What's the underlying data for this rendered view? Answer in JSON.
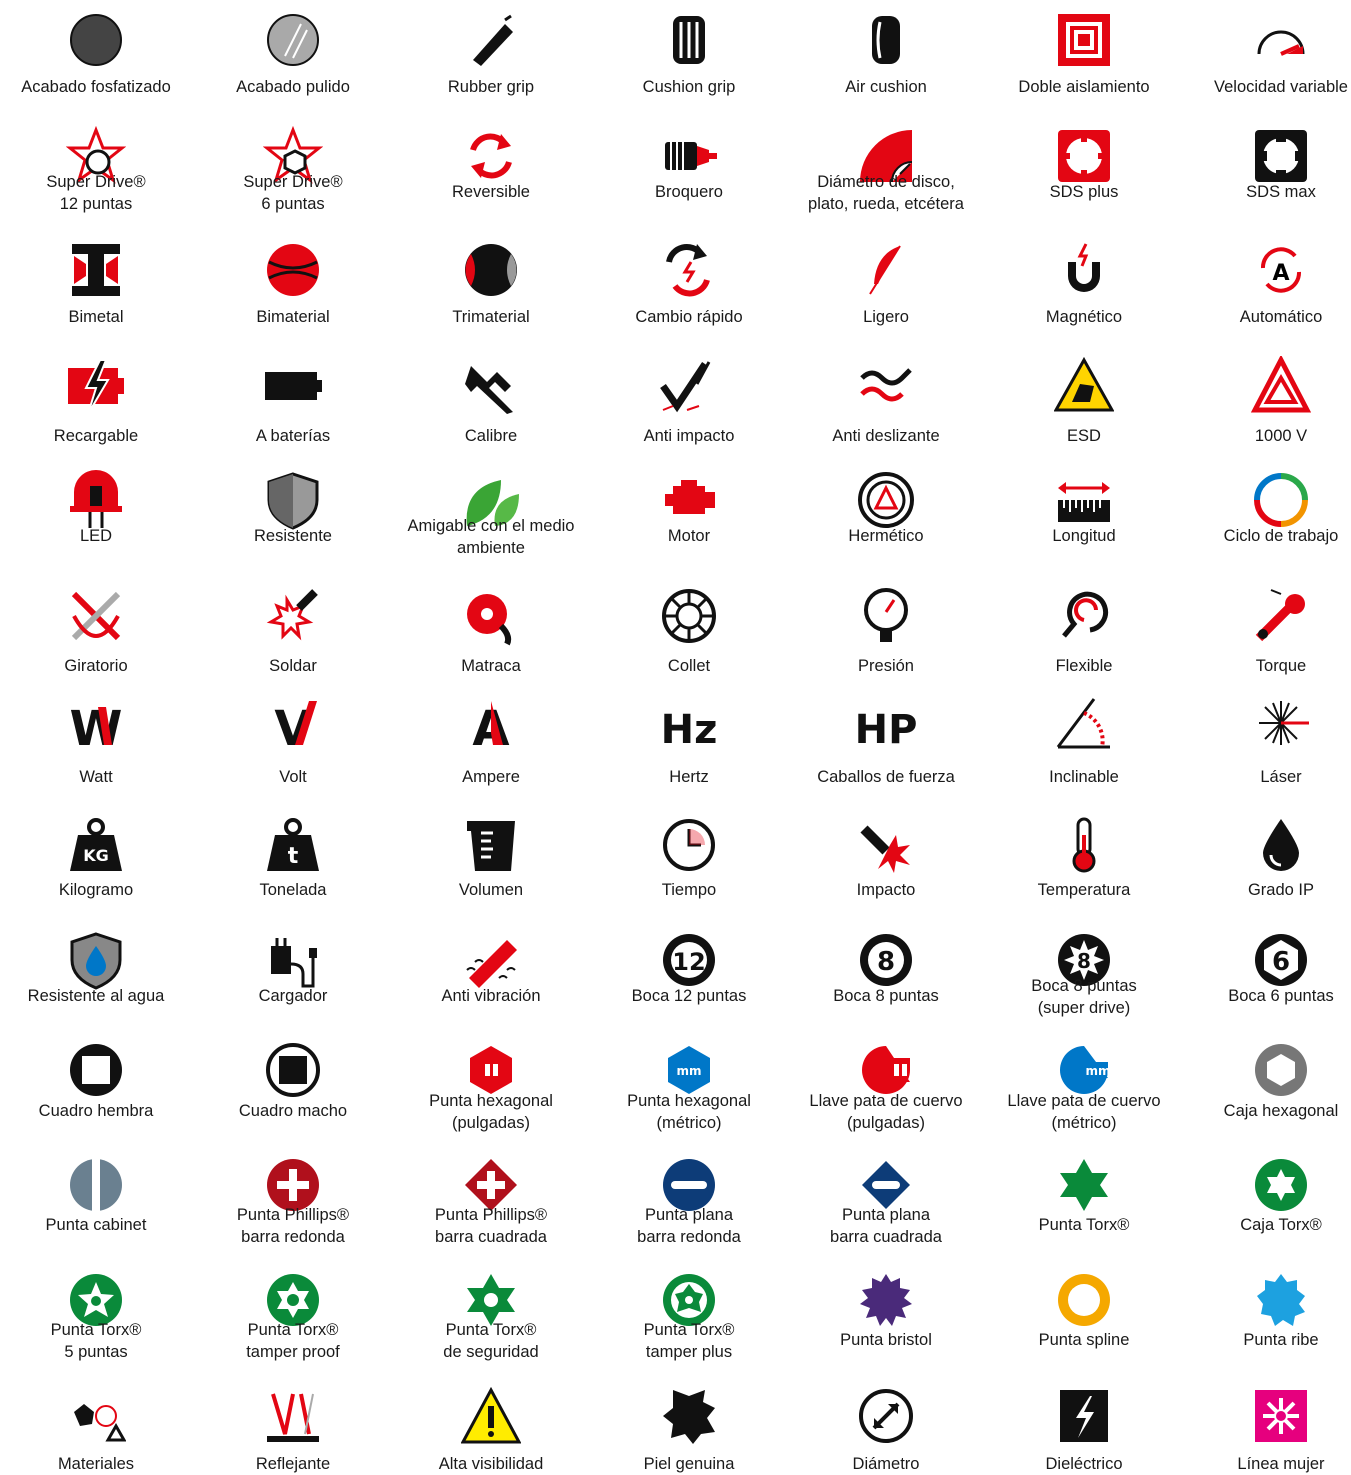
{
  "colors": {
    "red": "#e30613",
    "black": "#111111",
    "gray": "#8a8a8a",
    "green": "#0a8a3a",
    "blue": "#0077c8"
  },
  "icons": [
    {
      "name": "phosphate-finish-icon",
      "lines": [
        "Acabado fosfatizado"
      ]
    },
    {
      "name": "polished-finish-icon",
      "lines": [
        "Acabado pulido"
      ]
    },
    {
      "name": "rubber-grip-icon",
      "lines": [
        "Rubber grip"
      ]
    },
    {
      "name": "cushion-grip-icon",
      "lines": [
        "Cushion grip"
      ]
    },
    {
      "name": "air-cushion-icon",
      "lines": [
        "Air cushion"
      ]
    },
    {
      "name": "double-insulation-icon",
      "lines": [
        "Doble aislamiento"
      ]
    },
    {
      "name": "variable-speed-icon",
      "lines": [
        "Velocidad variable"
      ]
    },
    {
      "name": "super-drive-12-icon",
      "lines": [
        "Super Drive®",
        "12 puntas"
      ]
    },
    {
      "name": "super-drive-6-icon",
      "lines": [
        "Super Drive®",
        "6 puntas"
      ]
    },
    {
      "name": "reversible-icon",
      "lines": [
        "Reversible"
      ]
    },
    {
      "name": "chuck-icon",
      "lines": [
        "Broquero"
      ]
    },
    {
      "name": "disc-diameter-icon",
      "lines": [
        "Diámetro de disco,",
        "plato, rueda, etcétera"
      ]
    },
    {
      "name": "sds-plus-icon",
      "lines": [
        "SDS plus"
      ]
    },
    {
      "name": "sds-max-icon",
      "lines": [
        "SDS max"
      ]
    },
    {
      "name": "bimetal-icon",
      "lines": [
        "Bimetal"
      ]
    },
    {
      "name": "bimaterial-icon",
      "lines": [
        "Bimaterial"
      ]
    },
    {
      "name": "trimaterial-icon",
      "lines": [
        "Trimaterial"
      ]
    },
    {
      "name": "quick-change-icon",
      "lines": [
        "Cambio rápido"
      ]
    },
    {
      "name": "lightweight-feather-icon",
      "lines": [
        "Ligero"
      ]
    },
    {
      "name": "magnetic-icon",
      "lines": [
        "Magnético"
      ]
    },
    {
      "name": "automatic-icon",
      "lines": [
        "Automático"
      ]
    },
    {
      "name": "rechargeable-icon",
      "lines": [
        "Recargable"
      ]
    },
    {
      "name": "battery-icon",
      "lines": [
        "A baterías"
      ]
    },
    {
      "name": "caliper-icon",
      "lines": [
        "Calibre"
      ]
    },
    {
      "name": "anti-impact-icon",
      "lines": [
        "Anti impacto"
      ]
    },
    {
      "name": "anti-slip-icon",
      "lines": [
        "Anti deslizante"
      ]
    },
    {
      "name": "esd-icon",
      "lines": [
        "ESD"
      ]
    },
    {
      "name": "1000v-icon",
      "lines": [
        "1000 V"
      ]
    },
    {
      "name": "led-icon",
      "lines": [
        "LED"
      ]
    },
    {
      "name": "resistant-shield-icon",
      "lines": [
        "Resistente"
      ]
    },
    {
      "name": "eco-leaf-icon",
      "lines": [
        "Amigable con el medio",
        "ambiente"
      ]
    },
    {
      "name": "motor-icon",
      "lines": [
        "Motor"
      ]
    },
    {
      "name": "hermetic-icon",
      "lines": [
        "Hermético"
      ]
    },
    {
      "name": "length-ruler-icon",
      "lines": [
        "Longitud"
      ]
    },
    {
      "name": "duty-cycle-icon",
      "lines": [
        "Ciclo de trabajo"
      ]
    },
    {
      "name": "swivel-icon",
      "lines": [
        "Giratorio"
      ]
    },
    {
      "name": "solder-icon",
      "lines": [
        "Soldar"
      ]
    },
    {
      "name": "ratchet-icon",
      "lines": [
        "Matraca"
      ]
    },
    {
      "name": "collet-icon",
      "lines": [
        "Collet"
      ]
    },
    {
      "name": "pressure-gauge-icon",
      "lines": [
        "Presión"
      ]
    },
    {
      "name": "flexible-icon",
      "lines": [
        "Flexible"
      ]
    },
    {
      "name": "torque-wrench-icon",
      "lines": [
        "Torque"
      ]
    },
    {
      "name": "watt-icon",
      "lines": [
        "Watt"
      ]
    },
    {
      "name": "volt-icon",
      "lines": [
        "Volt"
      ]
    },
    {
      "name": "ampere-icon",
      "lines": [
        "Ampere"
      ]
    },
    {
      "name": "hertz-icon",
      "lines": [
        "Hertz"
      ]
    },
    {
      "name": "horsepower-icon",
      "lines": [
        "Caballos de fuerza"
      ]
    },
    {
      "name": "tiltable-icon",
      "lines": [
        "Inclinable"
      ]
    },
    {
      "name": "laser-icon",
      "lines": [
        "Láser"
      ]
    },
    {
      "name": "kilogram-icon",
      "lines": [
        "Kilogramo"
      ]
    },
    {
      "name": "ton-icon",
      "lines": [
        "Tonelada"
      ]
    },
    {
      "name": "volume-icon",
      "lines": [
        "Volumen"
      ]
    },
    {
      "name": "clock-icon",
      "lines": [
        "Tiempo"
      ]
    },
    {
      "name": "impact-icon",
      "lines": [
        "Impacto"
      ]
    },
    {
      "name": "thermometer-icon",
      "lines": [
        "Temperatura"
      ]
    },
    {
      "name": "ip-drop-icon",
      "lines": [
        "Grado IP"
      ]
    },
    {
      "name": "water-resistant-icon",
      "lines": [
        "Resistente al agua"
      ]
    },
    {
      "name": "charger-icon",
      "lines": [
        "Cargador"
      ]
    },
    {
      "name": "anti-vibration-icon",
      "lines": [
        "Anti vibración"
      ]
    },
    {
      "name": "socket-12-point-icon",
      "lines": [
        "Boca 12 puntas"
      ]
    },
    {
      "name": "socket-8-point-icon",
      "lines": [
        "Boca 8 puntas"
      ]
    },
    {
      "name": "socket-8-superdrive-icon",
      "lines": [
        "Boca 8 puntas",
        "(super drive)"
      ]
    },
    {
      "name": "socket-6-point-icon",
      "lines": [
        "Boca 6 puntas"
      ]
    },
    {
      "name": "square-female-icon",
      "lines": [
        "Cuadro hembra"
      ]
    },
    {
      "name": "square-male-icon",
      "lines": [
        "Cuadro macho"
      ]
    },
    {
      "name": "hex-bit-inch-icon",
      "lines": [
        "Punta hexagonal",
        "(pulgadas)"
      ]
    },
    {
      "name": "hex-bit-metric-icon",
      "lines": [
        "Punta hexagonal",
        "(métrico)"
      ]
    },
    {
      "name": "crowfoot-inch-icon",
      "lines": [
        "Llave pata de cuervo",
        "(pulgadas)"
      ]
    },
    {
      "name": "crowfoot-metric-icon",
      "lines": [
        "Llave pata de cuervo",
        "(métrico)"
      ]
    },
    {
      "name": "hex-socket-icon",
      "lines": [
        "Caja hexagonal"
      ]
    },
    {
      "name": "cabinet-tip-icon",
      "lines": [
        "Punta cabinet"
      ]
    },
    {
      "name": "phillips-round-icon",
      "lines": [
        "Punta Phillips®",
        "barra redonda"
      ]
    },
    {
      "name": "phillips-square-icon",
      "lines": [
        "Punta Phillips®",
        "barra cuadrada"
      ]
    },
    {
      "name": "flat-round-icon",
      "lines": [
        "Punta plana",
        "barra redonda"
      ]
    },
    {
      "name": "flat-square-icon",
      "lines": [
        "Punta plana",
        "barra cuadrada"
      ]
    },
    {
      "name": "torx-tip-icon",
      "lines": [
        "Punta Torx®"
      ]
    },
    {
      "name": "torx-socket-icon",
      "lines": [
        "Caja Torx®"
      ]
    },
    {
      "name": "torx-5-point-icon",
      "lines": [
        "Punta Torx®",
        "5 puntas"
      ]
    },
    {
      "name": "torx-tamper-proof-icon",
      "lines": [
        "Punta Torx®",
        "tamper proof"
      ]
    },
    {
      "name": "torx-security-icon",
      "lines": [
        "Punta Torx®",
        "de seguridad"
      ]
    },
    {
      "name": "torx-tamper-plus-icon",
      "lines": [
        "Punta Torx®",
        "tamper plus"
      ]
    },
    {
      "name": "bristol-tip-icon",
      "lines": [
        "Punta bristol"
      ]
    },
    {
      "name": "spline-tip-icon",
      "lines": [
        "Punta spline"
      ]
    },
    {
      "name": "ribe-tip-icon",
      "lines": [
        "Punta ribe"
      ]
    },
    {
      "name": "materials-icon",
      "lines": [
        "Materiales"
      ]
    },
    {
      "name": "reflective-icon",
      "lines": [
        "Reflejante"
      ]
    },
    {
      "name": "high-visibility-icon",
      "lines": [
        "Alta visibilidad"
      ]
    },
    {
      "name": "genuine-leather-icon",
      "lines": [
        "Piel genuina"
      ]
    },
    {
      "name": "diameter-icon",
      "lines": [
        "Diámetro"
      ]
    },
    {
      "name": "dielectric-icon",
      "lines": [
        "Dieléctrico"
      ]
    },
    {
      "name": "women-line-icon",
      "lines": [
        "Línea mujer"
      ]
    }
  ]
}
